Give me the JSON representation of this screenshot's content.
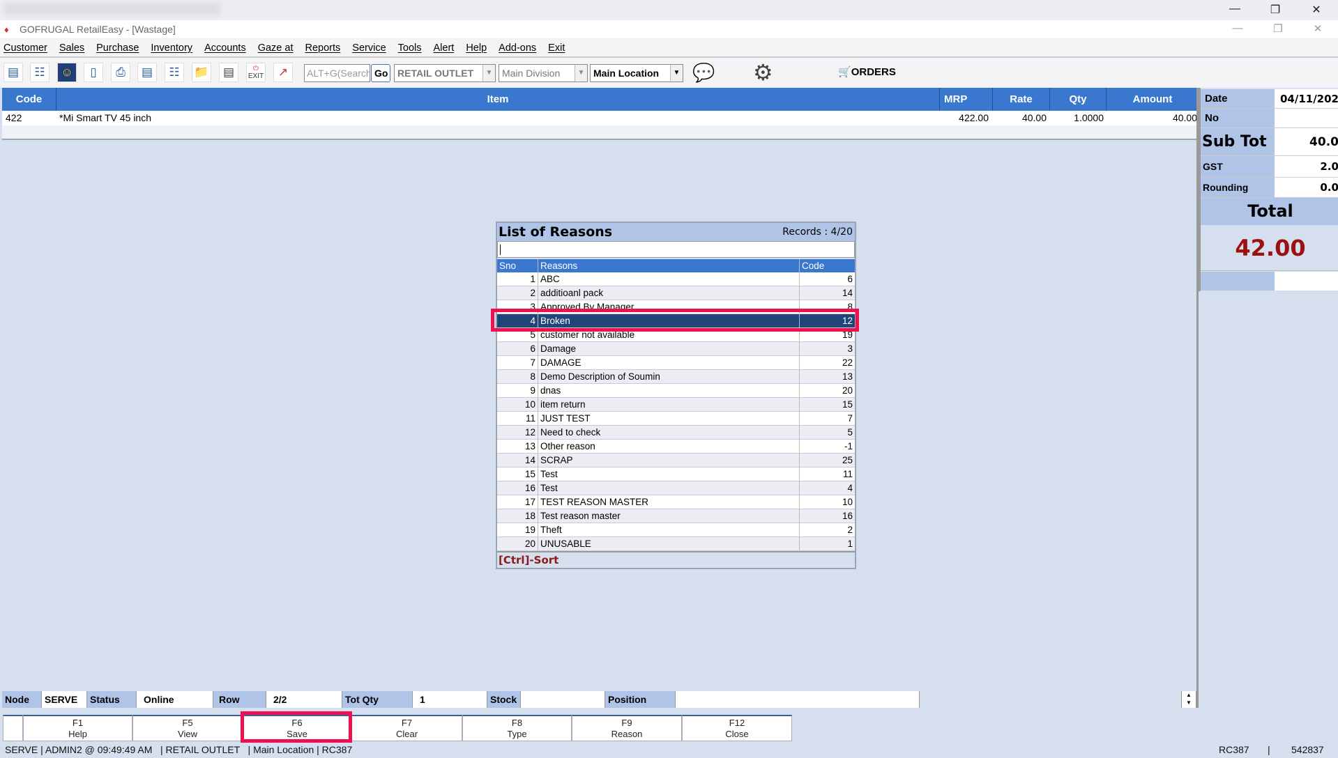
{
  "window": {
    "title": "GOFRUGAL RetailEasy - [Wastage]"
  },
  "menu": [
    "Customer",
    "Sales",
    "Purchase",
    "Inventory",
    "Accounts",
    "Gaze at",
    "Reports",
    "Service",
    "Tools",
    "Alert",
    "Help",
    "Add-ons",
    "Exit"
  ],
  "toolbar": {
    "search_placeholder": "ALT+G(Search",
    "go": "Go",
    "outlet": "RETAIL OUTLET",
    "division": "Main Division",
    "location": "Main Location",
    "orders": "ORDERS",
    "exit_label": "EXIT"
  },
  "grid": {
    "headers": [
      "Code",
      "Item",
      "MRP",
      "Rate",
      "Qty",
      "Amount"
    ],
    "rows": [
      {
        "code": "422",
        "item": "*Mi Smart TV 45 inch",
        "mrp": "422.00",
        "rate": "40.00",
        "qty": "1.0000",
        "amount": "40.00"
      }
    ]
  },
  "summary": {
    "date_label": "Date",
    "date": "04/11/202",
    "no_label": "No",
    "no": "",
    "subtot_label": "Sub Tot",
    "subtot": "40.0",
    "gst_label": "GST",
    "gst": "2.0",
    "rounding_label": "Rounding",
    "rounding": "0.0",
    "total_label": "Total",
    "total": "42.00"
  },
  "dialog": {
    "title": "List of Reasons",
    "records": "Records : 4/20",
    "headers": [
      "Sno",
      "Reasons",
      "Code"
    ],
    "footer": "[Ctrl]-Sort",
    "selected": 4,
    "rows": [
      [
        "1",
        "ABC",
        "6"
      ],
      [
        "2",
        "additioanl pack",
        "14"
      ],
      [
        "3",
        "Approved By Manager",
        "8"
      ],
      [
        "4",
        "Broken",
        "12"
      ],
      [
        "5",
        "customer not available",
        "19"
      ],
      [
        "6",
        "Damage",
        "3"
      ],
      [
        "7",
        "DAMAGE",
        "22"
      ],
      [
        "8",
        "Demo Description of Soumin",
        "13"
      ],
      [
        "9",
        "dnas",
        "20"
      ],
      [
        "10",
        "item return",
        "15"
      ],
      [
        "11",
        "JUST TEST",
        "7"
      ],
      [
        "12",
        "Need to check",
        "5"
      ],
      [
        "13",
        "Other reason",
        "-1"
      ],
      [
        "14",
        "SCRAP",
        "25"
      ],
      [
        "15",
        "Test",
        "11"
      ],
      [
        "16",
        "Test",
        "4"
      ],
      [
        "17",
        "TEST REASON MASTER",
        "10"
      ],
      [
        "18",
        "Test reason master",
        "16"
      ],
      [
        "19",
        "Theft",
        "2"
      ],
      [
        "20",
        "UNUSABLE",
        "1"
      ]
    ]
  },
  "status": {
    "node_label": "Node",
    "node": "SERVE",
    "status_label": "Status",
    "status": "Online",
    "row_label": "Row",
    "row": "2/2",
    "totqty_label": "Tot Qty",
    "totqty": "1",
    "stock_label": "Stock",
    "stock": "",
    "position_label": "Position",
    "position": ""
  },
  "fkeys": [
    [
      "F1",
      "Help"
    ],
    [
      "F5",
      "View"
    ],
    [
      "F6",
      "Save"
    ],
    [
      "F7",
      "Clear"
    ],
    [
      "F8",
      "Type"
    ],
    [
      "F9",
      "Reason"
    ],
    [
      "F12",
      "Close"
    ]
  ],
  "bottom": {
    "left": "SERVE | ADMIN2 @ 09:49:49 AM   | RETAIL OUTLET   | Main Location | RC387",
    "code": "RC387",
    "sep": "|",
    "number": "542837"
  },
  "colors": {
    "header_blue": "#3a78d0",
    "selected_row": "#1f4579",
    "highlight": "#f0104f",
    "total_red": "#9b1010"
  }
}
